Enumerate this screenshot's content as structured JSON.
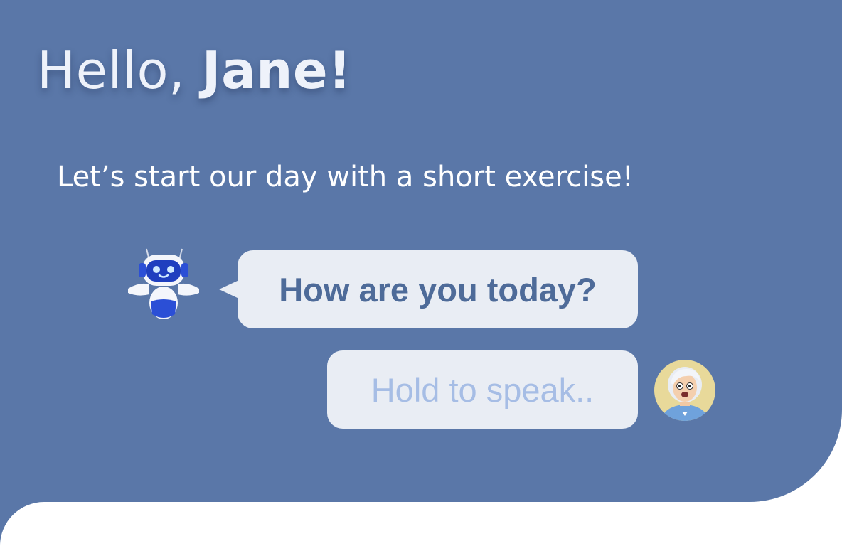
{
  "greeting": {
    "hello": "Hello,",
    "name": "Jane!"
  },
  "subtitle": "Let’s start our day with a short exercise!",
  "chat": {
    "bot_message": "How are you today?",
    "user_prompt": "Hold to speak.."
  },
  "icons": {
    "bot_avatar": "robot-icon",
    "user_avatar": "user-avatar"
  },
  "colors": {
    "background": "#5a77a8",
    "bubble": "#e9edf4",
    "bot_text": "#4e6b99",
    "placeholder_text": "#a6bde5"
  }
}
